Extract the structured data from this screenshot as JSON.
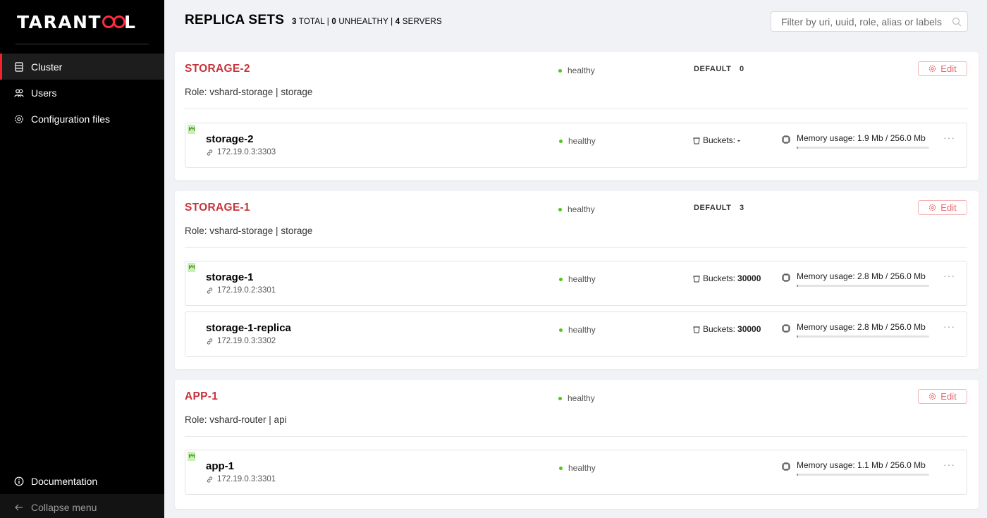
{
  "app": {
    "logo_left": "TARANT",
    "logo_right": "L"
  },
  "sidebar": {
    "items": [
      {
        "label": "Cluster",
        "icon": "server-icon",
        "active": true
      },
      {
        "label": "Users",
        "icon": "users-icon",
        "active": false
      },
      {
        "label": "Configuration files",
        "icon": "gear-icon",
        "active": false
      }
    ],
    "bottom": [
      {
        "label": "Documentation",
        "icon": "info-icon"
      },
      {
        "label": "Collapse menu",
        "icon": "arrow-left-icon"
      }
    ]
  },
  "header": {
    "title": "REPLICA SETS",
    "stats": {
      "total": "3",
      "total_label": "TOTAL",
      "unhealthy": "0",
      "unhealthy_label": "UNHEALTHY",
      "servers": "4",
      "servers_label": "SERVERS"
    },
    "filter_placeholder": "Filter by uri, uuid, role, alias or labels"
  },
  "colors": {
    "accent": "#c8333b",
    "healthy": "#52c41a",
    "sidebar_bg": "#000000"
  },
  "replicasets": [
    {
      "name": "STORAGE-2",
      "status": "healthy",
      "vshard_group": "DEFAULT",
      "weight": "0",
      "roles": "Role: vshard-storage | storage",
      "edit_label": "Edit",
      "servers": [
        {
          "alias": "storage-2",
          "uri": "172.19.0.3:3303",
          "status": "healthy",
          "leader": true,
          "buckets_label": "Buckets:",
          "buckets": "-",
          "memory": "Memory usage: 1.9 Mb / 256.0 Mb",
          "memory_fraction": 0.0074
        }
      ]
    },
    {
      "name": "STORAGE-1",
      "status": "healthy",
      "vshard_group": "DEFAULT",
      "weight": "3",
      "roles": "Role: vshard-storage | storage",
      "edit_label": "Edit",
      "servers": [
        {
          "alias": "storage-1",
          "uri": "172.19.0.2:3301",
          "status": "healthy",
          "leader": true,
          "buckets_label": "Buckets:",
          "buckets": "30000",
          "memory": "Memory usage: 2.8 Mb / 256.0 Mb",
          "memory_fraction": 0.011
        },
        {
          "alias": "storage-1-replica",
          "uri": "172.19.0.3:3302",
          "status": "healthy",
          "leader": false,
          "buckets_label": "Buckets:",
          "buckets": "30000",
          "memory": "Memory usage: 2.8 Mb / 256.0 Mb",
          "memory_fraction": 0.011
        }
      ]
    },
    {
      "name": "APP-1",
      "status": "healthy",
      "roles": "Role: vshard-router | api",
      "edit_label": "Edit",
      "servers": [
        {
          "alias": "app-1",
          "uri": "172.19.0.3:3301",
          "status": "healthy",
          "leader": true,
          "memory": "Memory usage: 1.1 Mb / 256.0 Mb",
          "memory_fraction": 0.0043
        }
      ]
    }
  ]
}
